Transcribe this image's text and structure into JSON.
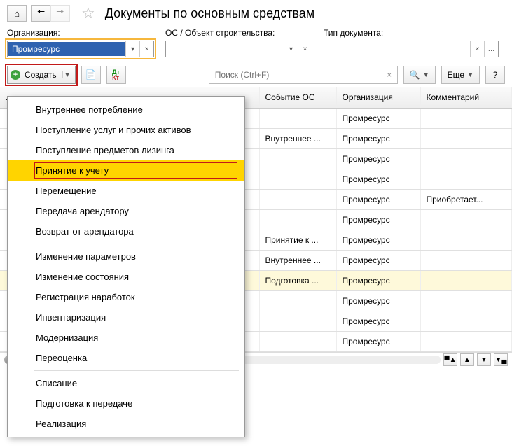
{
  "page_title": "Документы по основным средствам",
  "filters": {
    "org_label": "Организация:",
    "org_value": "Промресурс",
    "os_label": "ОС / Объект строительства:",
    "os_value": "",
    "doctype_label": "Тип документа:",
    "doctype_value": ""
  },
  "toolbar": {
    "create_label": "Создать",
    "search_placeholder": "Поиск (Ctrl+F)",
    "more_label": "Еще",
    "help_label": "?"
  },
  "columns": {
    "c1": "...",
    "c2": "Событие ОС",
    "c3": "Организация",
    "c4": "Комментарий"
  },
  "rows": [
    {
      "c1": "",
      "c2": "",
      "c3": "Промресурс",
      "c4": "",
      "hl": false
    },
    {
      "c1": "",
      "c2": "Внутреннее ...",
      "c3": "Промресурс",
      "c4": "",
      "hl": false
    },
    {
      "c1": "",
      "c2": "",
      "c3": "Промресурс",
      "c4": "",
      "hl": false
    },
    {
      "c1": "",
      "c2": "",
      "c3": "Промресурс",
      "c4": "",
      "hl": false
    },
    {
      "c1": "",
      "c2": "",
      "c3": "Промресурс",
      "c4": "Приобретает...",
      "hl": false
    },
    {
      "c1": "",
      "c2": "",
      "c3": "Промресурс",
      "c4": "",
      "hl": false
    },
    {
      "c1": "",
      "c2": "Принятие к ...",
      "c3": "Промресурс",
      "c4": "",
      "hl": false
    },
    {
      "c1": "",
      "c2": "Внутреннее ...",
      "c3": "Промресурс",
      "c4": "",
      "hl": false
    },
    {
      "c1": "",
      "c2": "Подготовка ...",
      "c3": "Промресурс",
      "c4": "",
      "hl": true
    },
    {
      "c1": "",
      "c2": "",
      "c3": "Промресурс",
      "c4": "",
      "hl": false
    },
    {
      "c1": "",
      "c2": "",
      "c3": "Промресурс",
      "c4": "",
      "hl": false
    },
    {
      "c1": "",
      "c2": "",
      "c3": "Промресурс",
      "c4": "",
      "hl": false
    }
  ],
  "menu": {
    "items": [
      {
        "label": "Внутреннее потребление"
      },
      {
        "label": "Поступление услуг и прочих активов"
      },
      {
        "label": "Поступление предметов лизинга"
      },
      {
        "label": "Принятие к учету",
        "selected": true
      },
      {
        "label": "Перемещение"
      },
      {
        "label": "Передача арендатору"
      },
      {
        "label": "Возврат от арендатора"
      },
      {
        "divider": true
      },
      {
        "label": "Изменение параметров"
      },
      {
        "label": "Изменение состояния"
      },
      {
        "label": "Регистрация наработок"
      },
      {
        "label": "Инвентаризация"
      },
      {
        "label": "Модернизация"
      },
      {
        "label": "Переоценка"
      },
      {
        "divider": true
      },
      {
        "label": "Списание"
      },
      {
        "label": "Подготовка к передаче"
      },
      {
        "label": "Реализация"
      }
    ]
  }
}
